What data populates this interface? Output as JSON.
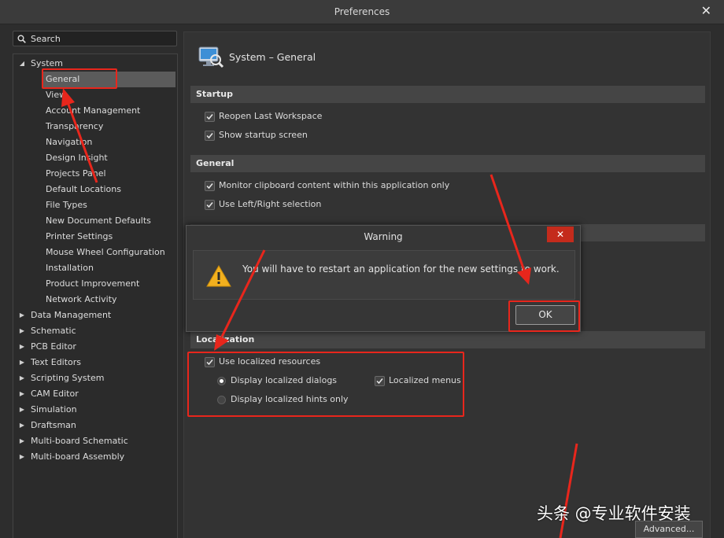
{
  "window": {
    "title": "Preferences",
    "close_glyph": "✕"
  },
  "search": {
    "placeholder": "Search",
    "value": "",
    "icon": "search-icon"
  },
  "tree": {
    "system_label": "System",
    "system_children": [
      "General",
      "View",
      "Account Management",
      "Transparency",
      "Navigation",
      "Design Insight",
      "Projects Panel",
      "Default Locations",
      "File Types",
      "New Document Defaults",
      "Printer Settings",
      "Mouse Wheel Configuration",
      "Installation",
      "Product Improvement",
      "Network Activity"
    ],
    "selected": "General",
    "collapsed_roots": [
      "Data Management",
      "Schematic",
      "PCB Editor",
      "Text Editors",
      "Scripting System",
      "CAM Editor",
      "Simulation",
      "Draftsman",
      "Multi-board Schematic",
      "Multi-board Assembly"
    ]
  },
  "main": {
    "page_title": "System – General",
    "page_icon": "system-monitor-icon",
    "sections": {
      "startup": {
        "label": "Startup",
        "options": [
          {
            "label": "Reopen Last Workspace",
            "checked": true
          },
          {
            "label": "Show startup screen",
            "checked": true
          }
        ]
      },
      "general": {
        "label": "General",
        "options": [
          {
            "label": "Monitor clipboard content within this application only",
            "checked": true
          },
          {
            "label": "Use Left/Right selection",
            "checked": true
          }
        ]
      },
      "localization": {
        "label": "Localization",
        "use_localized": {
          "label": "Use localized resources",
          "checked": true
        },
        "radio_dialogs": {
          "label": "Display localized dialogs",
          "selected": true
        },
        "radio_hints": {
          "label": "Display localized hints only",
          "selected": false
        },
        "localized_menus": {
          "label": "Localized menus",
          "checked": true
        }
      }
    },
    "advanced_label": "Advanced..."
  },
  "dialog": {
    "title": "Warning",
    "close_glyph": "✕",
    "message": "You will have to restart an application for the new settings to work.",
    "ok_label": "OK",
    "icon": "warning-icon"
  },
  "watermark": "头条 @专业软件安装",
  "colors": {
    "background": "#2d2d2d",
    "panel": "#333333",
    "section_header": "#454545",
    "selection": "#5b5b5b",
    "annotation_red": "#e8261c",
    "dialog_close_red": "#c42b1c",
    "warning_yellow": "#f2b01e"
  }
}
